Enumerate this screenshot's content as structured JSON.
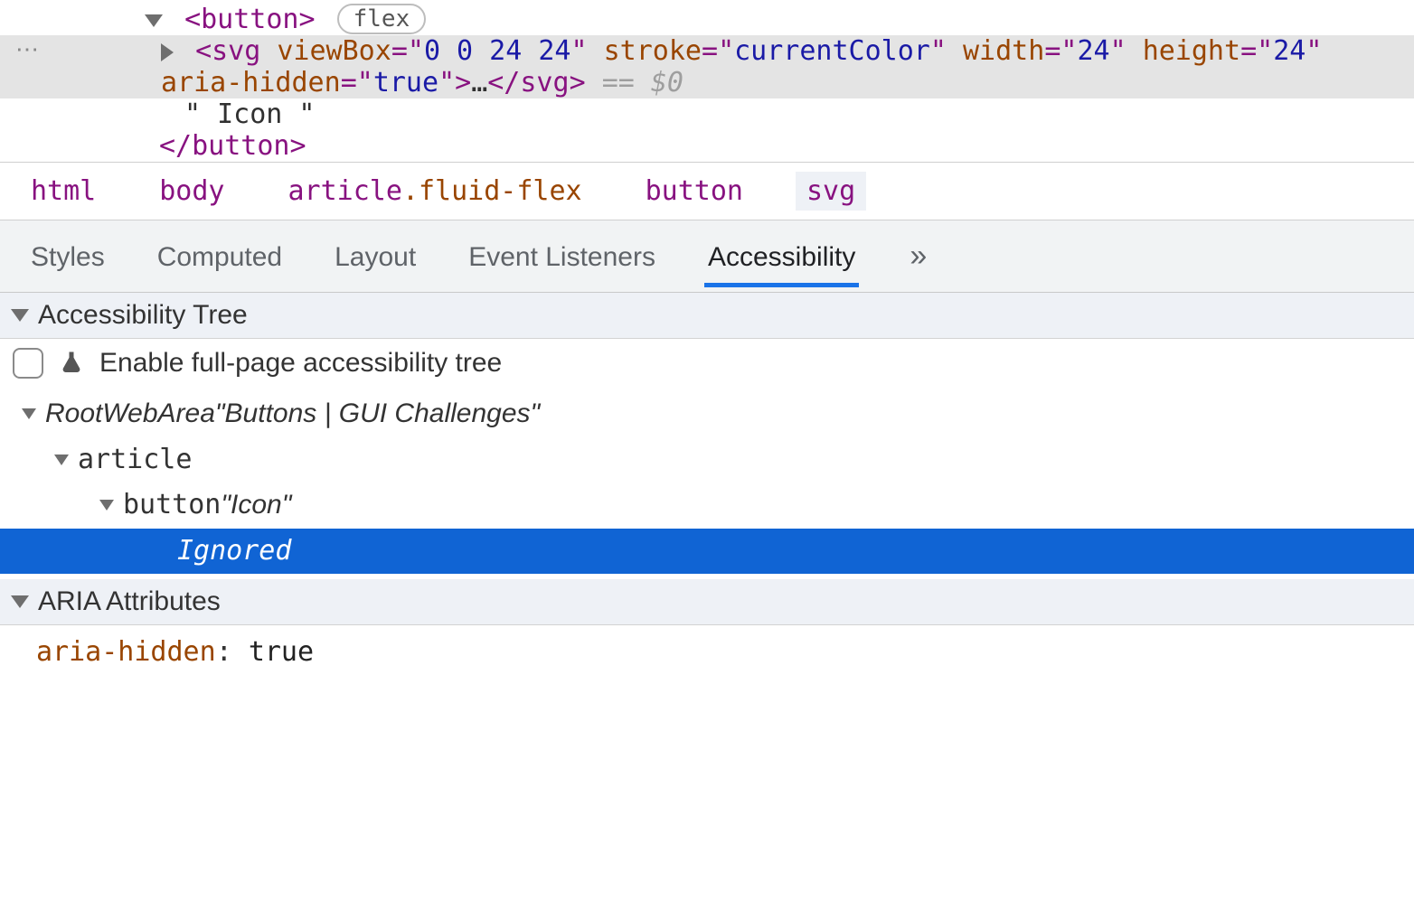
{
  "dom": {
    "button_open": "<button>",
    "button_close": "</button>",
    "flex_pill": "flex",
    "svg_tag": "svg",
    "svg_attrs": [
      {
        "name": "viewBox",
        "value": "0 0 24 24"
      },
      {
        "name": "stroke",
        "value": "currentColor"
      },
      {
        "name": "width",
        "value": "24"
      },
      {
        "name": "height",
        "value": "24"
      },
      {
        "name": "aria-hidden",
        "value": "true"
      }
    ],
    "svg_collapsed_inner": "…",
    "svg_close": "</svg>",
    "selected_hint": "== $0",
    "text_node": "\" Icon \"",
    "gutter_ellipsis": "⋯"
  },
  "breadcrumbs": [
    {
      "tag": "html",
      "cls": "",
      "active": false
    },
    {
      "tag": "body",
      "cls": "",
      "active": false
    },
    {
      "tag": "article",
      "cls": ".fluid-flex",
      "active": false
    },
    {
      "tag": "button",
      "cls": "",
      "active": false
    },
    {
      "tag": "svg",
      "cls": "",
      "active": true
    }
  ],
  "tabs": {
    "items": [
      "Styles",
      "Computed",
      "Layout",
      "Event Listeners",
      "Accessibility"
    ],
    "active": 4,
    "overflow": "»"
  },
  "a11y": {
    "section_tree": "Accessibility Tree",
    "enable_label": "Enable full-page accessibility tree",
    "tree": [
      {
        "depth": 0,
        "role": "RootWebArea",
        "name": "Buttons | GUI Challenges",
        "selected": false
      },
      {
        "depth": 1,
        "role": "article",
        "name": "",
        "selected": false
      },
      {
        "depth": 2,
        "role": "button",
        "name": "Icon",
        "selected": false
      },
      {
        "depth": 3,
        "role": "",
        "name": "Ignored",
        "selected": true,
        "plain": true
      }
    ],
    "section_aria": "ARIA Attributes",
    "aria_attr": {
      "name": "aria-hidden",
      "value": "true"
    }
  }
}
